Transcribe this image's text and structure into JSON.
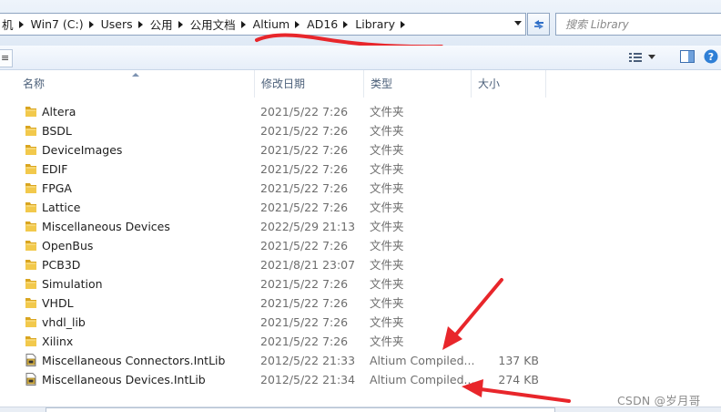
{
  "address_bar": {
    "crumbs": [
      "机",
      "Win7 (C:)",
      "Users",
      "公用",
      "公用文档",
      "Altium",
      "AD16",
      "Library"
    ]
  },
  "search": {
    "placeholder": "搜索 Library"
  },
  "toolbar": {
    "stub_label": "≡"
  },
  "columns": {
    "name": "名称",
    "date": "修改日期",
    "type": "类型",
    "size": "大小"
  },
  "files": [
    {
      "name": "Altera",
      "date": "2021/5/22 7:26",
      "type": "文件夹",
      "size": "",
      "icon": "folder-icon"
    },
    {
      "name": "BSDL",
      "date": "2021/5/22 7:26",
      "type": "文件夹",
      "size": "",
      "icon": "folder-icon"
    },
    {
      "name": "DeviceImages",
      "date": "2021/5/22 7:26",
      "type": "文件夹",
      "size": "",
      "icon": "folder-icon"
    },
    {
      "name": "EDIF",
      "date": "2021/5/22 7:26",
      "type": "文件夹",
      "size": "",
      "icon": "folder-icon"
    },
    {
      "name": "FPGA",
      "date": "2021/5/22 7:26",
      "type": "文件夹",
      "size": "",
      "icon": "folder-icon"
    },
    {
      "name": "Lattice",
      "date": "2021/5/22 7:26",
      "type": "文件夹",
      "size": "",
      "icon": "folder-icon"
    },
    {
      "name": "Miscellaneous Devices",
      "date": "2022/5/29 21:13",
      "type": "文件夹",
      "size": "",
      "icon": "folder-icon"
    },
    {
      "name": "OpenBus",
      "date": "2021/5/22 7:26",
      "type": "文件夹",
      "size": "",
      "icon": "folder-icon"
    },
    {
      "name": "PCB3D",
      "date": "2021/8/21 23:07",
      "type": "文件夹",
      "size": "",
      "icon": "folder-icon"
    },
    {
      "name": "Simulation",
      "date": "2021/5/22 7:26",
      "type": "文件夹",
      "size": "",
      "icon": "folder-icon"
    },
    {
      "name": "VHDL",
      "date": "2021/5/22 7:26",
      "type": "文件夹",
      "size": "",
      "icon": "folder-icon"
    },
    {
      "name": "vhdl_lib",
      "date": "2021/5/22 7:26",
      "type": "文件夹",
      "size": "",
      "icon": "folder-icon"
    },
    {
      "name": "Xilinx",
      "date": "2021/5/22 7:26",
      "type": "文件夹",
      "size": "",
      "icon": "folder-icon"
    },
    {
      "name": "Miscellaneous Connectors.IntLib",
      "date": "2012/5/22 21:33",
      "type": "Altium Compiled...",
      "size": "137 KB",
      "icon": "intlib-file-icon"
    },
    {
      "name": "Miscellaneous Devices.IntLib",
      "date": "2012/5/22 21:34",
      "type": "Altium Compiled...",
      "size": "274 KB",
      "icon": "intlib-file-icon"
    }
  ],
  "watermark": "CSDN @岁月哥",
  "colors": {
    "annotation_red": "#e8262b",
    "folder_yellow": "#f2c94c",
    "header_text": "#4c607a"
  }
}
